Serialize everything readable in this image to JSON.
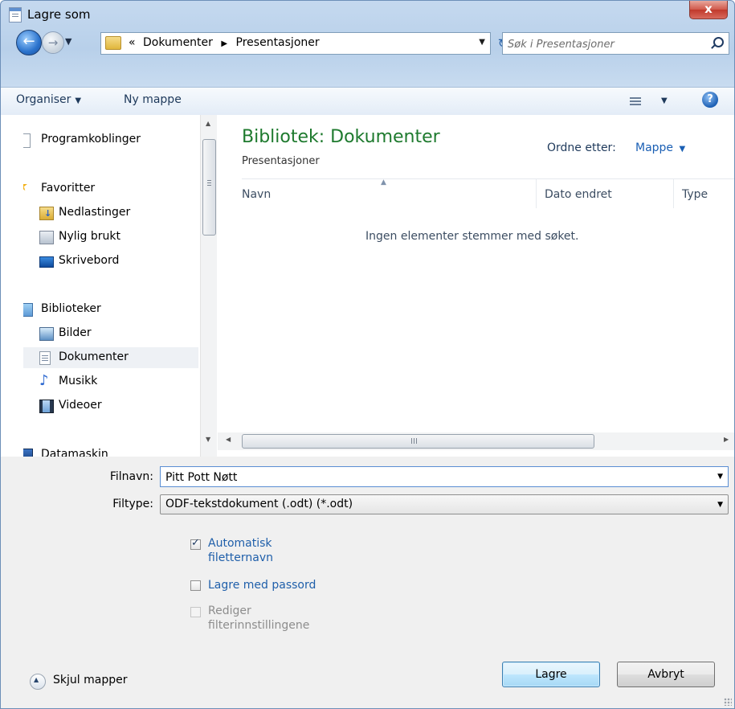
{
  "window": {
    "title": "Lagre som",
    "close_label": "x"
  },
  "nav": {
    "back_icon": "back-arrow-icon",
    "forward_icon": "forward-arrow-icon",
    "address": {
      "prefix": "«",
      "crumbs": [
        "Dokumenter",
        "Presentasjoner"
      ]
    },
    "search_placeholder": "Søk i Presentasjoner"
  },
  "toolbar": {
    "organize": "Organiser",
    "new_folder": "Ny mappe"
  },
  "sidebar": {
    "items": [
      {
        "label": "Programkoblinger",
        "icon": "shortcut-page-icon"
      },
      {
        "label": "Favoritter",
        "icon": "star-icon"
      },
      {
        "label": "Nedlastinger",
        "icon": "downloads-folder-icon"
      },
      {
        "label": "Nylig brukt",
        "icon": "recent-places-icon"
      },
      {
        "label": "Skrivebord",
        "icon": "desktop-icon"
      },
      {
        "label": "Biblioteker",
        "icon": "libraries-icon"
      },
      {
        "label": "Bilder",
        "icon": "pictures-icon"
      },
      {
        "label": "Dokumenter",
        "icon": "documents-icon",
        "selected": true
      },
      {
        "label": "Musikk",
        "icon": "music-icon"
      },
      {
        "label": "Videoer",
        "icon": "videos-icon"
      },
      {
        "label": "Datamaskin",
        "icon": "computer-icon"
      }
    ]
  },
  "content": {
    "title": "Bibliotek: Dokumenter",
    "subtitle": "Presentasjoner",
    "arrange_label": "Ordne etter:",
    "arrange_value": "Mappe",
    "columns": [
      "Navn",
      "Dato endret",
      "Type"
    ],
    "empty_message": "Ingen elementer stemmer med søket."
  },
  "form": {
    "filename_label": "Filnavn:",
    "filename_value": "Pitt Pott Nøtt",
    "filetype_label": "Filtype:",
    "filetype_value": "ODF-tekstdokument (.odt) (*.odt)",
    "options": [
      {
        "label_line1": "Automatisk",
        "label_line2": "filetternavn",
        "checked": true,
        "enabled": true
      },
      {
        "label_line1": "Lagre med passord",
        "checked": false,
        "enabled": true
      },
      {
        "label_line1": "Rediger",
        "label_line2": "filterinnstillingene",
        "checked": false,
        "enabled": false
      }
    ]
  },
  "footer": {
    "hide_folders": "Skjul mapper",
    "save": "Lagre",
    "cancel": "Avbryt"
  }
}
